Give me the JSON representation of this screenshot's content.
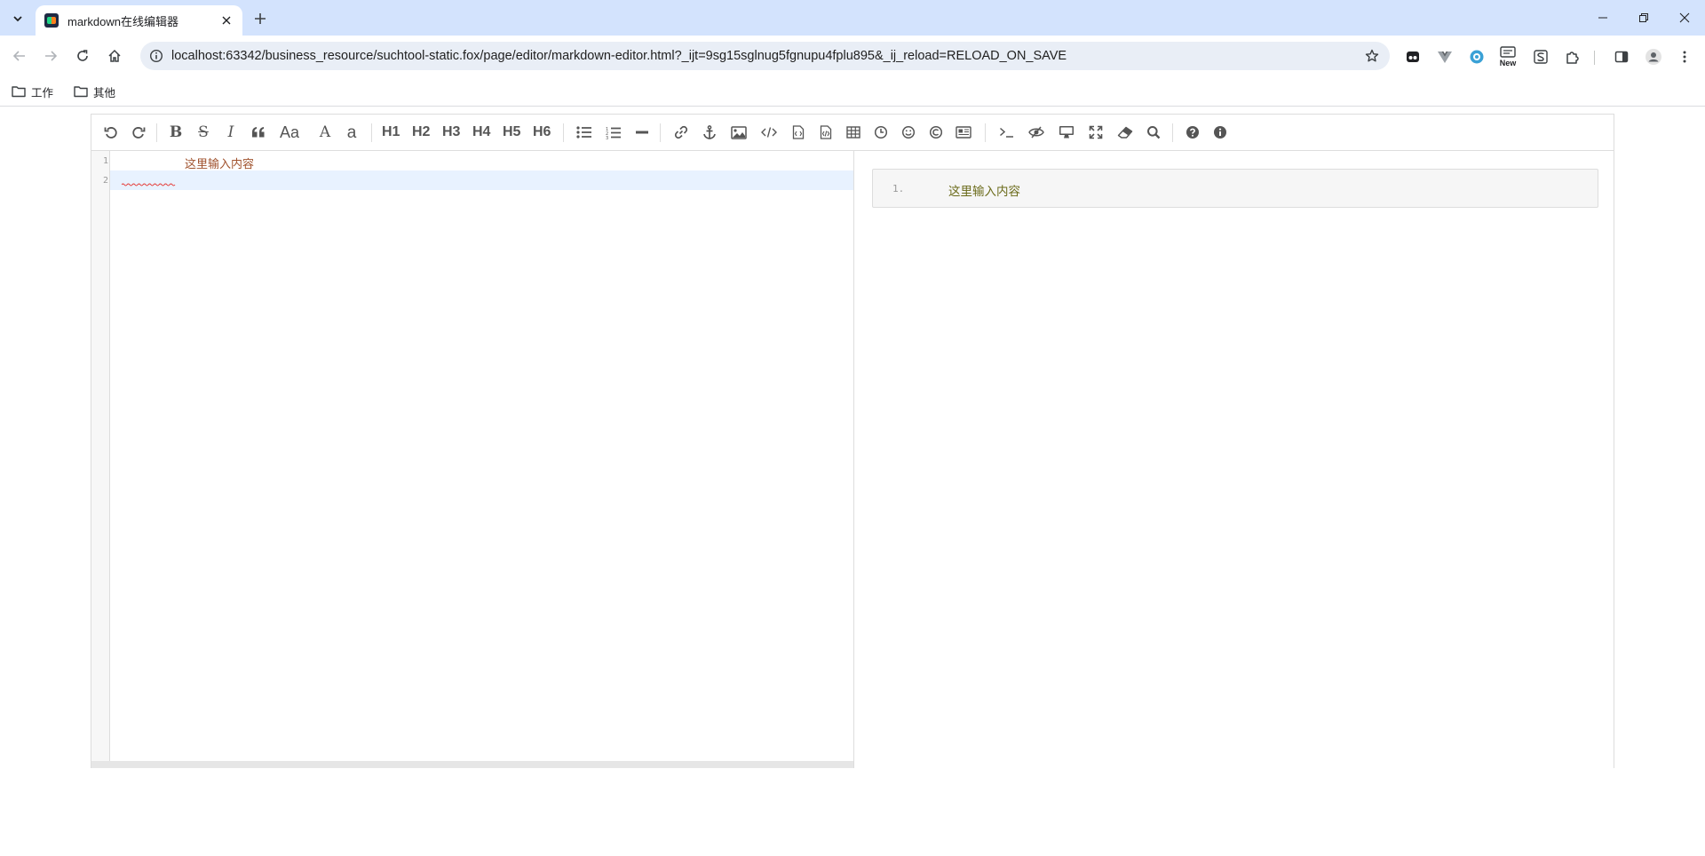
{
  "browser": {
    "tab": {
      "title": "markdown在线编辑器"
    },
    "url": "localhost:63342/business_resource/suchtool-static.fox/page/editor/markdown-editor.html?_ijt=9sg15sglnug5fgnupu4fplu895&_ij_reload=RELOAD_ON_SAVE",
    "ext_new_label": "New",
    "bookmarks": [
      {
        "label": "工作"
      },
      {
        "label": "其他"
      }
    ]
  },
  "editor": {
    "toolbar": {
      "headings": [
        "H1",
        "H2",
        "H3",
        "H4",
        "H5",
        "H6"
      ],
      "case_label": "Aa",
      "upper_label": "A",
      "lower_label": "a"
    },
    "code_lines": [
      {
        "number": "1",
        "text": "这里输入内容"
      },
      {
        "number": "2",
        "text": ""
      }
    ],
    "preview": {
      "lines": [
        {
          "number": "1.",
          "text": "这里输入内容"
        }
      ]
    }
  },
  "colors": {
    "tabstrip": "#d3e3fd",
    "omnibox": "#e9eef6",
    "code_text": "#a0522d",
    "preview_text": "#6b6b1a",
    "active_line": "#e8f2ff",
    "spellcheck": "#e53935"
  }
}
